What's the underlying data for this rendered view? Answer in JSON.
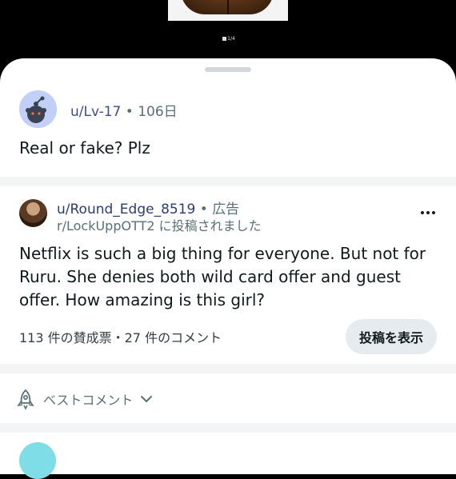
{
  "media": {
    "counter": "1/4"
  },
  "post": {
    "username": "u/Lv-17",
    "separator": "•",
    "age": "106日",
    "title": "Real or fake? Plz"
  },
  "ad": {
    "username": "u/Round_Edge_8519",
    "separator": "•",
    "label": "広告",
    "subline": "r/LockUppOTT2 に投稿されました",
    "body": "Netflix is such a big thing for everyone. But not for Ruru. She denies both wild card offer and guest offer. How amazing is this girl?",
    "stats": "113 件の賛成票・27 件のコメント",
    "view_post_label": "投稿を表示"
  },
  "comments": {
    "sort_label": "ベストコメント"
  },
  "colors": {
    "sheet_bg": "#ffffff",
    "divider": "#f2f4f5",
    "button_bg": "#e5ebee",
    "username": "#2a3c73"
  }
}
